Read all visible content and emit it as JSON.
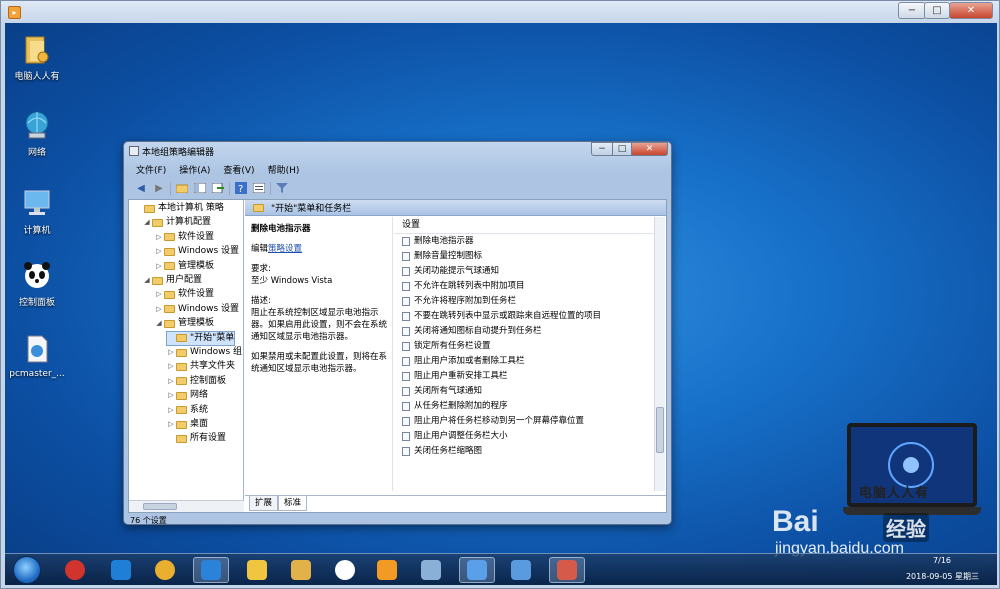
{
  "outer_window": {
    "title_controls": [
      "−",
      "□",
      "✕"
    ]
  },
  "desktop_icons": [
    {
      "label": "电脑人人有",
      "icon": "folder-user-icon"
    },
    {
      "label": "网络",
      "icon": "network-icon"
    },
    {
      "label": "计算机",
      "icon": "computer-icon"
    },
    {
      "label": "控制面板",
      "icon": "panda-icon"
    },
    {
      "label": "pcmaster_...",
      "icon": "file-icon"
    }
  ],
  "gpe": {
    "title": "本地组策略编辑器",
    "menu": [
      "文件(F)",
      "操作(A)",
      "查看(V)",
      "帮助(H)"
    ],
    "tree": [
      {
        "label": "本地计算机 策略",
        "level": 0
      },
      {
        "label": "计算机配置",
        "level": 1
      },
      {
        "label": "软件设置",
        "level": 2
      },
      {
        "label": "Windows 设置",
        "level": 2
      },
      {
        "label": "管理模板",
        "level": 2
      },
      {
        "label": "用户配置",
        "level": 1
      },
      {
        "label": "软件设置",
        "level": 2
      },
      {
        "label": "Windows 设置",
        "level": 2
      },
      {
        "label": "管理模板",
        "level": 2
      },
      {
        "label": "\"开始\"菜单",
        "level": 3,
        "selected": true
      },
      {
        "label": "Windows 组",
        "level": 3
      },
      {
        "label": "共享文件夹",
        "level": 3
      },
      {
        "label": "控制面板",
        "level": 3
      },
      {
        "label": "网络",
        "level": 3
      },
      {
        "label": "系统",
        "level": 3
      },
      {
        "label": "桌面",
        "level": 3
      },
      {
        "label": "所有设置",
        "level": 3
      }
    ],
    "header": "\"开始\"菜单和任务栏",
    "desc": {
      "title": "删除电池指示器",
      "edit_prefix": "编辑",
      "edit_link": "策略设置",
      "req_label": "要求:",
      "req_value": "至少 Windows Vista",
      "desc_label": "描述:",
      "desc_text1": "阻止在系统控制区域显示电池指示器。如果启用此设置，则不会在系统通知区域显示电池指示器。",
      "desc_text2": "如果禁用或未配置此设置，则将在系统通知区域显示电池指示器。"
    },
    "list_header": "设置",
    "list": [
      "删除电池指示器",
      "删除音量控制图标",
      "关闭功能提示气球通知",
      "不允许在跳转列表中附加项目",
      "不允许将程序附加到任务栏",
      "不要在跳转列表中显示或跟踪来自远程位置的项目",
      "关闭将通知图标自动提升到任务栏",
      "锁定所有任务栏设置",
      "阻止用户添加或者删除工具栏",
      "阻止用户重新安排工具栏",
      "关闭所有气球通知",
      "从任务栏删除附加的程序",
      "阻止用户将任务栏移动到另一个屏幕停靠位置",
      "阻止用户调整任务栏大小",
      "关闭任务栏缩略图"
    ],
    "tabs": [
      "扩展",
      "标准"
    ],
    "status": "76 个设置"
  },
  "taskbar": {
    "apps": [
      "red-app-icon",
      "ie-icon",
      "chrome-icon",
      "media-icon",
      "sticky-notes-icon",
      "explorer-icon",
      "pinwheel-icon",
      "player-icon",
      "paint-icon",
      "control-panel-icon",
      "cube-icon",
      "gpe-icon"
    ],
    "clock_time": "7/16",
    "clock_date": "2018-09-05 星期三"
  },
  "watermark": {
    "brand": "电脑人人有",
    "baidu": "Bai",
    "jingyan": "经验",
    "url": "jingyan.baidu.com"
  }
}
